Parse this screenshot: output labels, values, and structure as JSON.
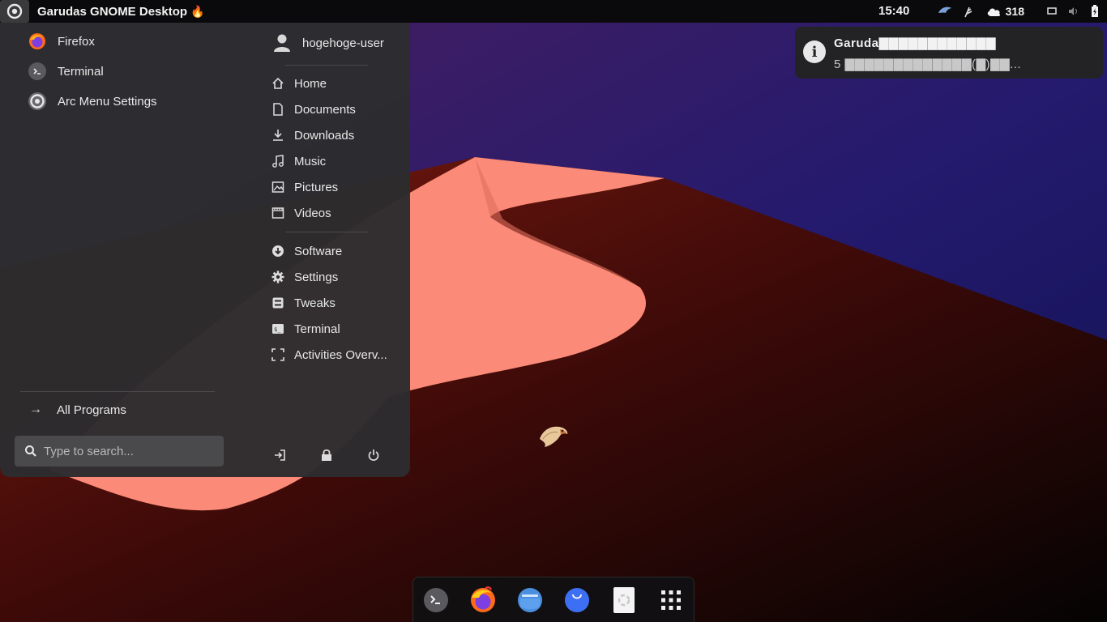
{
  "topbar": {
    "title": "Garudas GNOME Desktop",
    "title_emoji": "🔥",
    "clock": "15:40",
    "tray_count": "318",
    "icons": [
      "arc-menu-icon",
      "garuda-bird-icon",
      "feather-icon",
      "weather-icon",
      "screen-icon",
      "volume-icon",
      "battery-icon"
    ]
  },
  "arcmenu": {
    "pinned": [
      {
        "label": "Firefox",
        "icon": "firefox-icon"
      },
      {
        "label": "Terminal",
        "icon": "terminal-icon"
      },
      {
        "label": "Arc Menu Settings",
        "icon": "arc-menu-settings-icon"
      }
    ],
    "all_programs": "All Programs",
    "search_placeholder": "Type to search...",
    "user": "hogehoge-user",
    "places": [
      {
        "label": "Home",
        "icon": "home-icon"
      },
      {
        "label": "Documents",
        "icon": "document-icon"
      },
      {
        "label": "Downloads",
        "icon": "download-icon"
      },
      {
        "label": "Music",
        "icon": "music-icon"
      },
      {
        "label": "Pictures",
        "icon": "pictures-icon"
      },
      {
        "label": "Videos",
        "icon": "videos-icon"
      }
    ],
    "system": [
      {
        "label": "Software",
        "icon": "software-icon"
      },
      {
        "label": "Settings",
        "icon": "gear-icon"
      },
      {
        "label": "Tweaks",
        "icon": "tweaks-icon"
      },
      {
        "label": "Terminal",
        "icon": "terminal-icon"
      },
      {
        "label": "Activities Overv...",
        "icon": "activities-icon"
      }
    ],
    "power_buttons": [
      "log-out-icon",
      "lock-icon",
      "power-icon"
    ]
  },
  "notification": {
    "title": "Garuda▇▇▇▇▇▇▇▇▇▇▇▇",
    "body": "5 ▇▇▇▇▇▇▇▇▇▇▇▇▇(▇)▇▇..."
  },
  "dock": {
    "items": [
      "terminal-icon",
      "firefox-icon",
      "files-icon",
      "software-store-icon",
      "trash-icon",
      "app-grid-icon"
    ]
  },
  "colors": {
    "dune": "#fc8a78",
    "menu_bg": "#2c2c2e",
    "topbar_bg": "#0a0a0c"
  }
}
